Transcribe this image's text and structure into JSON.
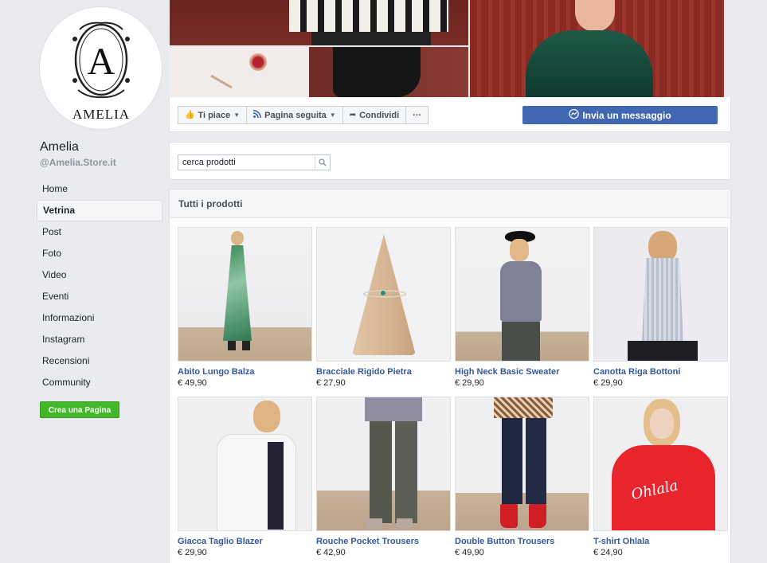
{
  "page": {
    "name": "Amelia",
    "handle": "@Amelia.Store.it",
    "logo_text": "AMELIA",
    "logo_letter": "A"
  },
  "nav": {
    "items": [
      {
        "label": "Home"
      },
      {
        "label": "Vetrina"
      },
      {
        "label": "Post"
      },
      {
        "label": "Foto"
      },
      {
        "label": "Video"
      },
      {
        "label": "Eventi"
      },
      {
        "label": "Informazioni"
      },
      {
        "label": "Instagram"
      },
      {
        "label": "Recensioni"
      },
      {
        "label": "Community"
      }
    ],
    "create_page": "Crea una Pagina"
  },
  "actions": {
    "like": "Ti piace",
    "follow": "Pagina seguita",
    "share": "Condividi",
    "more": "···",
    "message": "Invia un messaggio"
  },
  "search": {
    "value": "cerca prodotti"
  },
  "products": {
    "header": "Tutti i prodotti",
    "items": [
      {
        "name": "Abito Lungo Balza",
        "price": "€ 49,90"
      },
      {
        "name": "Bracciale Rigido Pietra",
        "price": "€ 27,90"
      },
      {
        "name": "High Neck Basic Sweater",
        "price": "€ 29,90"
      },
      {
        "name": "Canotta Riga Bottoni",
        "price": "€ 29,90"
      },
      {
        "name": "Giacca Taglio Blazer",
        "price": "€ 29,90"
      },
      {
        "name": "Rouche Pocket Trousers",
        "price": "€ 42,90"
      },
      {
        "name": "Double Button Trousers",
        "price": "€ 49,90"
      },
      {
        "name": "T-shirt Ohlala",
        "price": "€ 24,90"
      }
    ]
  },
  "colors": {
    "link": "#365899",
    "brand": "#4267b2",
    "create_green": "#42b72a"
  }
}
